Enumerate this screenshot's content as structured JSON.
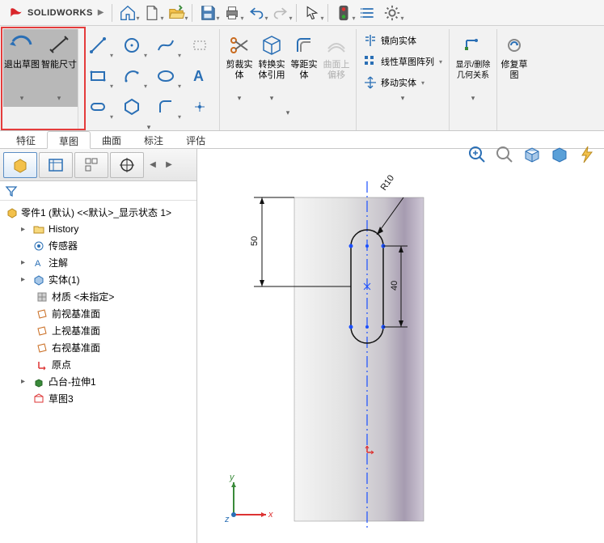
{
  "app": {
    "name": "SOLIDWORKS"
  },
  "ribbon": {
    "exit_sketch": "退出草图",
    "smart_dim": "智能尺寸",
    "trim": "剪裁实体",
    "convert": "转换实体引用",
    "offset": "等距实体",
    "surface_offset": "曲面上偏移",
    "mirror": "镜向实体",
    "linear_pattern": "线性草图阵列",
    "move": "移动实体",
    "display_relations": "显示/删除几何关系",
    "repair": "修复草图"
  },
  "tabs": {
    "features": "特征",
    "sketch": "草图",
    "surfaces": "曲面",
    "annotate": "标注",
    "evaluate": "评估"
  },
  "tree": {
    "root": "零件1 (默认) <<默认>_显示状态 1>",
    "history": "History",
    "sensors": "传感器",
    "annotations": "注解",
    "solid_bodies": "实体(1)",
    "material": "材质 <未指定>",
    "front_plane": "前视基准面",
    "top_plane": "上视基准面",
    "right_plane": "右视基准面",
    "origin": "原点",
    "extrude": "凸台-拉伸1",
    "sketch3": "草图3"
  },
  "dims": {
    "h50": "50",
    "h40": "40",
    "r10": "R10"
  },
  "triad": {
    "x": "x",
    "y": "y",
    "z": "z"
  }
}
